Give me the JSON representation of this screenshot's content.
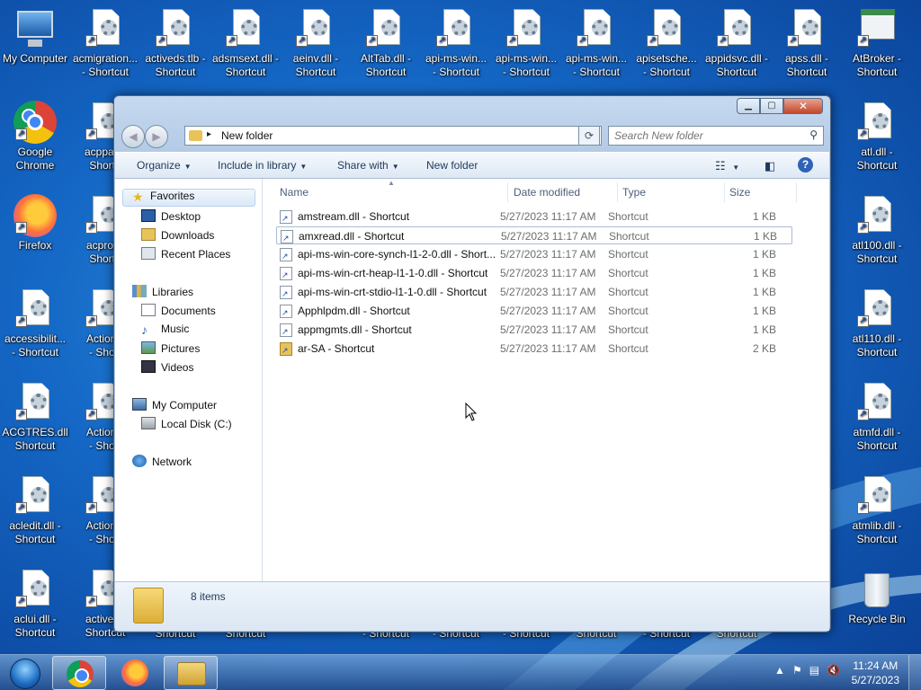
{
  "desktop": {
    "icons_top": [
      {
        "name": "my-computer-desktop",
        "line1": "My Computer",
        "line2": ""
      },
      {
        "name": "acmigration-shortcut",
        "line1": "acmigration...",
        "line2": "- Shortcut"
      },
      {
        "name": "activeds-tlb-shortcut",
        "line1": "activeds.tlb -",
        "line2": "Shortcut"
      },
      {
        "name": "adsmsext-shortcut",
        "line1": "adsmsext.dll -",
        "line2": "Shortcut"
      },
      {
        "name": "aeinv-shortcut",
        "line1": "aeinv.dll -",
        "line2": "Shortcut"
      },
      {
        "name": "alttab-shortcut",
        "line1": "AltTab.dll -",
        "line2": "Shortcut"
      },
      {
        "name": "api-ms-win-1-shortcut",
        "line1": "api-ms-win...",
        "line2": "- Shortcut"
      },
      {
        "name": "api-ms-win-2-shortcut",
        "line1": "api-ms-win...",
        "line2": "- Shortcut"
      },
      {
        "name": "api-ms-win-3-shortcut",
        "line1": "api-ms-win...",
        "line2": "- Shortcut"
      },
      {
        "name": "apisetsche-shortcut",
        "line1": "apisetsche...",
        "line2": "- Shortcut"
      },
      {
        "name": "appidsvc-shortcut",
        "line1": "appidsvc.dll -",
        "line2": "Shortcut"
      },
      {
        "name": "apss-shortcut",
        "line1": "apss.dll -",
        "line2": "Shortcut"
      },
      {
        "name": "atbroker-shortcut",
        "line1": "AtBroker -",
        "line2": "Shortcut"
      }
    ],
    "icons_left": [
      {
        "name": "google-chrome-desktop",
        "line1": "Google",
        "line2": "Chrome",
        "kind": "chrome"
      },
      {
        "name": "firefox-desktop",
        "line1": "Firefox",
        "line2": "",
        "kind": "firefox"
      },
      {
        "name": "accessibility-shortcut",
        "line1": "accessibilit...",
        "line2": "- Shortcut",
        "kind": "file"
      },
      {
        "name": "acgtres-shortcut",
        "line1": "ACGTRES.dll",
        "line2": "Shortcut",
        "kind": "file"
      },
      {
        "name": "acledit-shortcut",
        "line1": "acledit.dll -",
        "line2": "Shortcut",
        "kind": "file"
      },
      {
        "name": "aclui-shortcut",
        "line1": "aclui.dll -",
        "line2": "Shortcut",
        "kind": "file"
      }
    ],
    "icons_left2": [
      {
        "name": "acppage-shortcut",
        "line1": "acppage",
        "line2": "Shorto"
      },
      {
        "name": "acproxy-shortcut",
        "line1": "acproxy",
        "line2": "Shorto"
      },
      {
        "name": "actionc-1-shortcut",
        "line1": "ActionC",
        "line2": "- Short"
      },
      {
        "name": "actionc-2-shortcut",
        "line1": "ActionC",
        "line2": "- Short"
      },
      {
        "name": "actionq-shortcut",
        "line1": "ActionQ",
        "line2": "- Short"
      },
      {
        "name": "activeds-shortcut",
        "line1": "activeds",
        "line2": "Shortcut"
      }
    ],
    "icons_right": [
      {
        "name": "atl-shortcut",
        "line1": "atl.dll -",
        "line2": "Shortcut"
      },
      {
        "name": "atl100-shortcut",
        "line1": "atl100.dll -",
        "line2": "Shortcut"
      },
      {
        "name": "atl110-shortcut",
        "line1": "atl110.dll -",
        "line2": "Shortcut"
      },
      {
        "name": "atmfd-shortcut",
        "line1": "atmfd.dll -",
        "line2": "Shortcut"
      },
      {
        "name": "atmlib-shortcut",
        "line1": "atmlib.dll -",
        "line2": "Shortcut"
      },
      {
        "name": "recycle-bin",
        "line1": "Recycle Bin",
        "line2": ""
      }
    ],
    "bottom_peek_labels": [
      "Shortcut",
      "Shortcut",
      "- Shortcut",
      "- Shortcut",
      "- Shortcut",
      "Shortcut",
      "- Shortcut",
      "Shortcut"
    ]
  },
  "window": {
    "address": {
      "path": "New folder"
    },
    "search": {
      "placeholder": "Search New folder"
    },
    "toolbar": {
      "organize": "Organize",
      "include": "Include in library",
      "share": "Share with",
      "new_folder": "New folder"
    },
    "nav": {
      "favorites": "Favorites",
      "desktop": "Desktop",
      "downloads": "Downloads",
      "recent": "Recent Places",
      "libraries": "Libraries",
      "documents": "Documents",
      "music": "Music",
      "pictures": "Pictures",
      "videos": "Videos",
      "computer": "My Computer",
      "local_disk": "Local Disk (C:)",
      "network": "Network"
    },
    "columns": {
      "name": "Name",
      "date": "Date modified",
      "type": "Type",
      "size": "Size"
    },
    "files": [
      {
        "name": "amstream.dll - Shortcut",
        "date": "5/27/2023 11:17 AM",
        "type": "Shortcut",
        "size": "1 KB"
      },
      {
        "name": "amxread.dll - Shortcut",
        "date": "5/27/2023 11:17 AM",
        "type": "Shortcut",
        "size": "1 KB"
      },
      {
        "name": "api-ms-win-core-synch-l1-2-0.dll - Short...",
        "date": "5/27/2023 11:17 AM",
        "type": "Shortcut",
        "size": "1 KB"
      },
      {
        "name": "api-ms-win-crt-heap-l1-1-0.dll - Shortcut",
        "date": "5/27/2023 11:17 AM",
        "type": "Shortcut",
        "size": "1 KB"
      },
      {
        "name": "api-ms-win-crt-stdio-l1-1-0.dll - Shortcut",
        "date": "5/27/2023 11:17 AM",
        "type": "Shortcut",
        "size": "1 KB"
      },
      {
        "name": "Apphlpdm.dll - Shortcut",
        "date": "5/27/2023 11:17 AM",
        "type": "Shortcut",
        "size": "1 KB"
      },
      {
        "name": "appmgmts.dll - Shortcut",
        "date": "5/27/2023 11:17 AM",
        "type": "Shortcut",
        "size": "1 KB"
      },
      {
        "name": "ar-SA - Shortcut",
        "date": "5/27/2023 11:17 AM",
        "type": "Shortcut",
        "size": "2 KB"
      }
    ],
    "status": {
      "count": "8 items"
    }
  },
  "taskbar": {
    "time": "11:24 AM",
    "date": "5/27/2023"
  }
}
